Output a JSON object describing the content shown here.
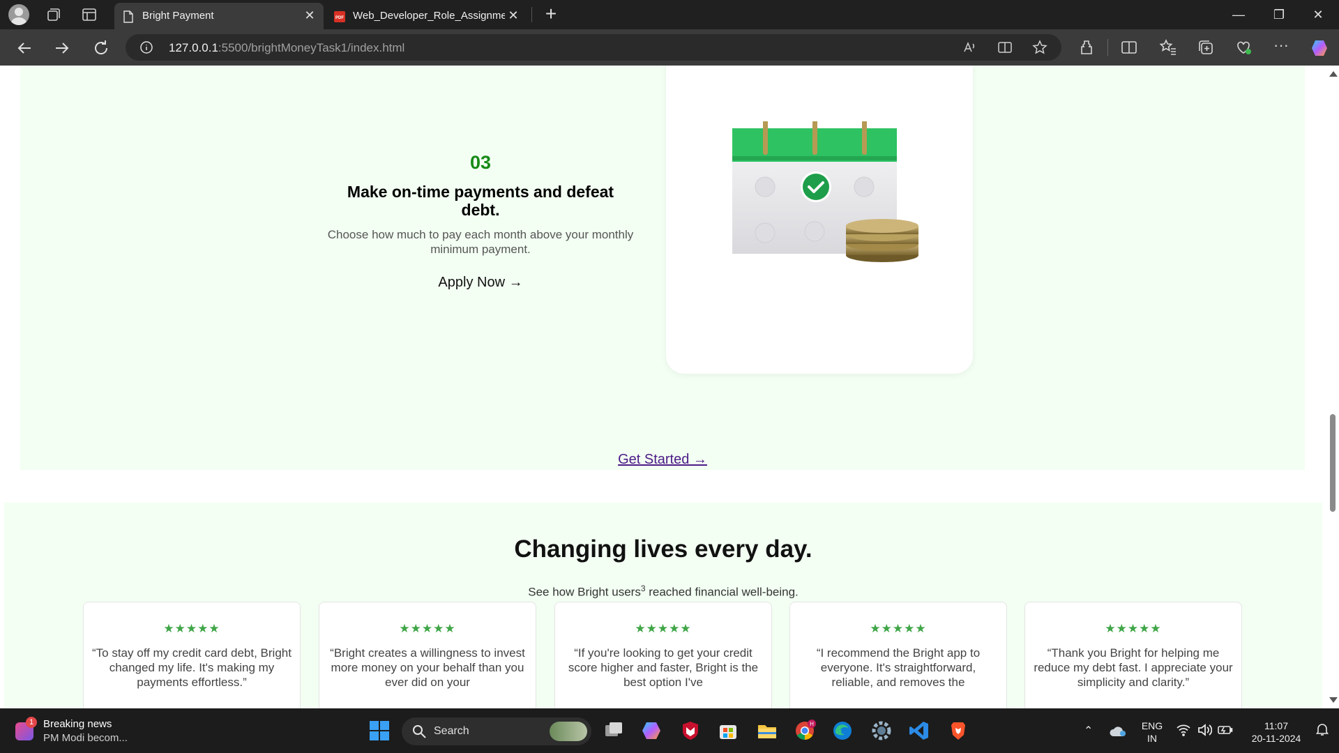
{
  "browser": {
    "tabs": [
      {
        "title": "Bright Payment",
        "active": true
      },
      {
        "title": "Web_Developer_Role_Assignment",
        "active": false
      }
    ],
    "address": {
      "host": "127.0.0.1",
      "path": ":5500/brightMoneyTask1/index.html"
    }
  },
  "step": {
    "number": "03",
    "title": "Make on-time payments and defeat debt.",
    "description": "Choose how much to pay each month above your monthly minimum payment.",
    "cta": "Apply Now →"
  },
  "get_started": "Get Started →",
  "testimonials": {
    "heading": "Changing lives every day.",
    "subtitle_before": "See how Bright users",
    "subtitle_sup": "3",
    "subtitle_after": " reached financial well-being.",
    "cards": [
      {
        "stars": "★★★★★",
        "quote": "“To stay off my credit card debt, Bright changed my life. It's making my payments effortless.”"
      },
      {
        "stars": "★★★★★",
        "quote": "“Bright creates a willingness to invest more money on your behalf than you ever did on your"
      },
      {
        "stars": "★★★★★",
        "quote": "“If you're looking to get your credit score higher and faster, Bright is the best option I've"
      },
      {
        "stars": "★★★★★",
        "quote": "“I recommend the Bright app to everyone. It's straightforward, reliable, and removes the"
      },
      {
        "stars": "★★★★★",
        "quote": "“Thank you Bright for helping me reduce my debt fast. I appreciate your simplicity and clarity.”"
      }
    ]
  },
  "taskbar": {
    "news_title": "Breaking news",
    "news_text": "PM Modi becom...",
    "news_badge": "1",
    "search_label": "Search",
    "lang_line1": "ENG",
    "lang_line2": "IN",
    "time": "11:07",
    "date": "20-11-2024"
  },
  "colors": {
    "step_green": "#178a17",
    "section_bg": "#f3fff3",
    "star_green": "#3fa547",
    "link_purple": "#4b1b86"
  }
}
